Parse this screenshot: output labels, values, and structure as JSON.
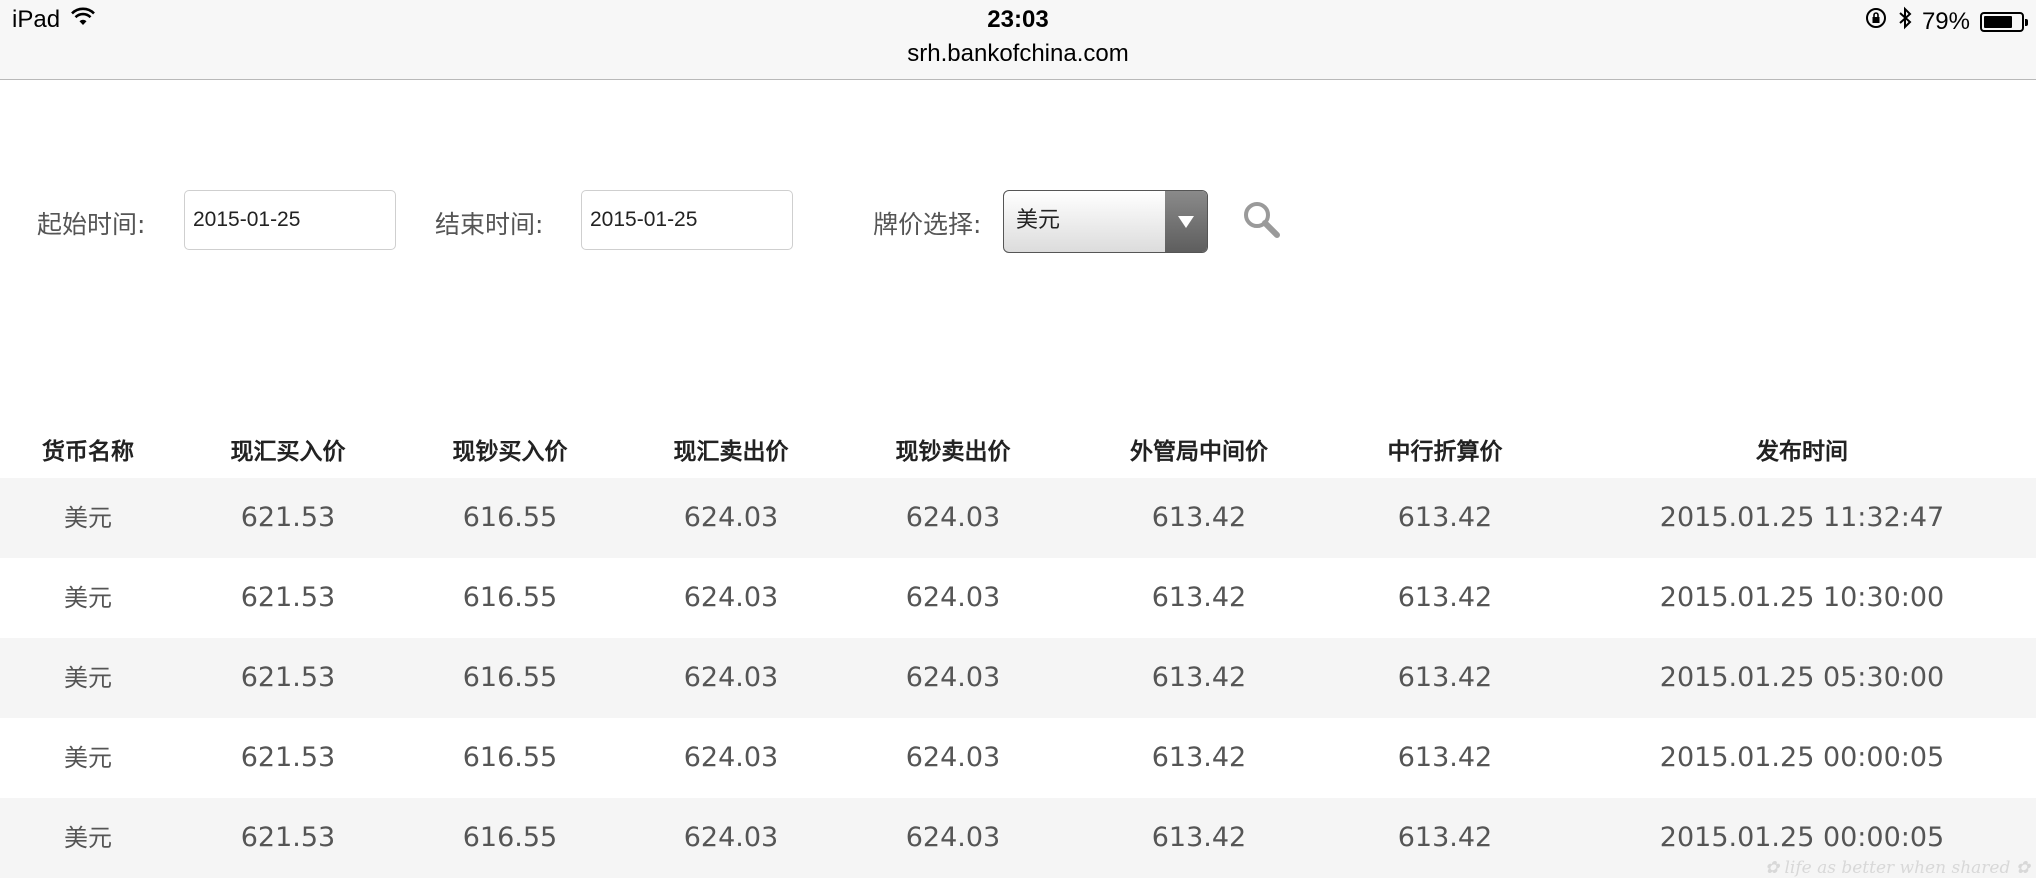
{
  "status_bar": {
    "device": "iPad",
    "time": "23:03",
    "url": "srh.bankofchina.com",
    "battery": "79%",
    "battery_level": 0.79
  },
  "filters": {
    "start_label": "起始时间:",
    "start_value": "2015-01-25",
    "end_label": "结束时间:",
    "end_value": "2015-01-25",
    "currency_label": "牌价选择:",
    "currency_value": "美元"
  },
  "table": {
    "columns": [
      "货币名称",
      "现汇买入价",
      "现钞买入价",
      "现汇卖出价",
      "现钞卖出价",
      "外管局中间价",
      "中行折算价",
      "发布时间"
    ],
    "rows": [
      [
        "美元",
        "621.53",
        "616.55",
        "624.03",
        "624.03",
        "613.42",
        "613.42",
        "2015.01.25 11:32:47"
      ],
      [
        "美元",
        "621.53",
        "616.55",
        "624.03",
        "624.03",
        "613.42",
        "613.42",
        "2015.01.25 10:30:00"
      ],
      [
        "美元",
        "621.53",
        "616.55",
        "624.03",
        "624.03",
        "613.42",
        "613.42",
        "2015.01.25 05:30:00"
      ],
      [
        "美元",
        "621.53",
        "616.55",
        "624.03",
        "624.03",
        "613.42",
        "613.42",
        "2015.01.25 00:00:05"
      ],
      [
        "美元",
        "621.53",
        "616.55",
        "624.03",
        "624.03",
        "613.42",
        "613.42",
        "2015.01.25 00:00:05"
      ]
    ]
  },
  "icons": {
    "wifi": "wifi-icon",
    "rotation_lock": "rotation-lock-icon",
    "bluetooth": "bluetooth-icon",
    "battery": "battery-icon",
    "dropdown": "triangle-down-icon",
    "search": "search-icon"
  }
}
